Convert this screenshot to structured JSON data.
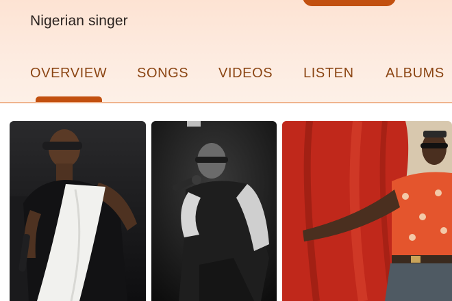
{
  "entity": {
    "subtitle": "Nigerian singer"
  },
  "tabs": [
    {
      "label": "OVERVIEW",
      "active": true
    },
    {
      "label": "SONGS",
      "active": false
    },
    {
      "label": "VIDEOS",
      "active": false
    },
    {
      "label": "LISTEN",
      "active": false
    },
    {
      "label": "ALBUMS",
      "active": false
    }
  ],
  "photos": [
    {
      "description": "singer-in-sunglasses-holding-mic-and-white-towel"
    },
    {
      "description": "singer-kneeling-with-mic-black-and-white"
    },
    {
      "description": "singer-posing-in-front-of-red-curtain"
    }
  ],
  "colors": {
    "accent": "#c2500f",
    "tab_text": "#8b4513",
    "header_bg": "#fde8dc"
  }
}
